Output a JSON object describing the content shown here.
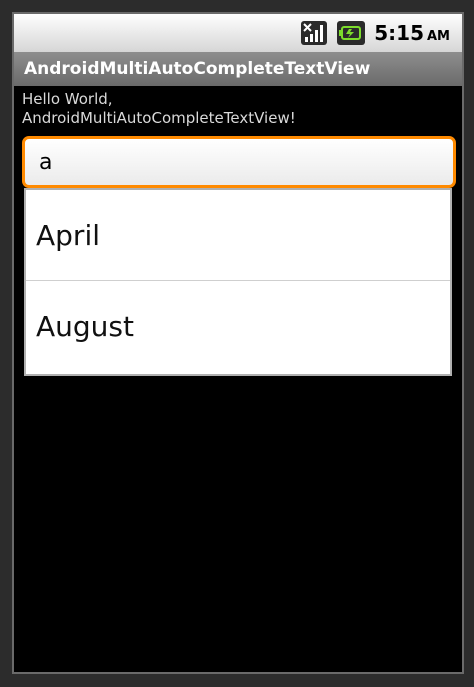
{
  "status_bar": {
    "time": "5:15",
    "ampm": "AM",
    "icons": [
      "signal-icon",
      "battery-icon"
    ]
  },
  "app": {
    "title": "AndroidMultiAutoCompleteTextView"
  },
  "content": {
    "hello_line1": "Hello World,",
    "hello_line2": "AndroidMultiAutoCompleteTextView!"
  },
  "input": {
    "value": "a"
  },
  "suggestions": [
    {
      "label": "April"
    },
    {
      "label": "August"
    }
  ],
  "colors": {
    "focus_border": "#ff8a00",
    "title_bar": "#7a7a7a",
    "background": "#000000"
  }
}
